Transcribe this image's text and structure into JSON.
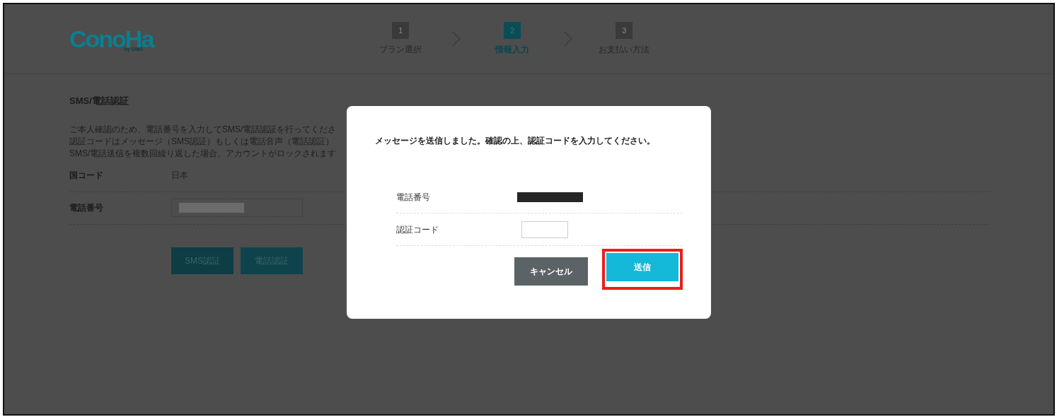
{
  "logo": {
    "name": "ConoHa",
    "sub": "by GMO"
  },
  "steps": [
    {
      "number": "1",
      "label": "プラン選択",
      "selected": false
    },
    {
      "number": "2",
      "label": "情報入力",
      "selected": true
    },
    {
      "number": "3",
      "label": "お支払い方法",
      "selected": false
    }
  ],
  "section": {
    "title": "SMS/電話認証",
    "description": [
      "ご本人確認のため、電話番号を入力してSMS/電話認証を行ってくださ",
      "認証コードはメッセージ（SMS認証）もしくは電話音声（電話認証）",
      "SMS/電話送信を複数回繰り返した場合、アカウントがロックされます"
    ],
    "fields": [
      {
        "kind": "text",
        "label": "国コード",
        "value": "日本"
      },
      {
        "kind": "redacted-input",
        "label": "電話番号"
      }
    ],
    "buttons": [
      "SMS認証",
      "電話認証"
    ]
  },
  "dialog": {
    "message": "メッセージを送信しました。確認の上、認証コードを入力してください。",
    "fields": [
      {
        "kind": "redacted",
        "label": "電話番号"
      },
      {
        "kind": "input",
        "label": "認証コード"
      }
    ],
    "buttons": [
      {
        "label": "キャンセル",
        "kind": "secondary",
        "highlighted": false
      },
      {
        "label": "送信",
        "kind": "primary",
        "highlighted": true
      }
    ]
  }
}
